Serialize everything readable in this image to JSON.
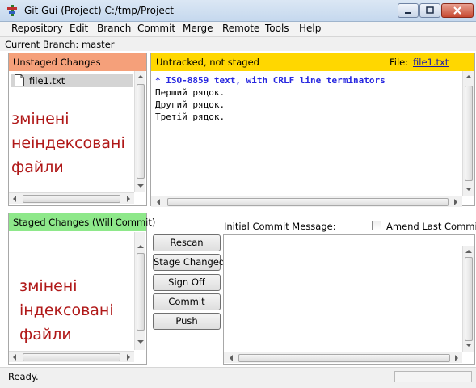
{
  "window": {
    "title": "Git Gui (Project) C:/tmp/Project"
  },
  "menu": [
    "Repository",
    "Edit",
    "Branch",
    "Commit",
    "Merge",
    "Remote",
    "Tools",
    "Help"
  ],
  "branch_line": "Current Branch: master",
  "unstaged": {
    "header": "Unstaged Changes",
    "header_color": "#f5a07a",
    "files": [
      "file1.txt"
    ],
    "annotation": [
      "змінені",
      "неіндексовані",
      "файли"
    ]
  },
  "diff": {
    "header_status": "Untracked, not staged",
    "header_color": "#ffd700",
    "file_label": "File:",
    "file_name": "file1.txt",
    "lines": [
      "* ISO-8859 text, with CRLF line terminators",
      "Перший рядок.",
      "Другий рядок.",
      "Третій рядок."
    ]
  },
  "staged": {
    "header": "Staged Changes (Will Commit)",
    "header_color": "#8ee88a",
    "annotation": [
      "змінені",
      "індексовані",
      "файли"
    ]
  },
  "commit": {
    "message_label": "Initial Commit Message:",
    "amend_label": "Amend Last Commit",
    "amend_checked": false,
    "message": ""
  },
  "buttons": [
    "Rescan",
    "Stage Changed",
    "Sign Off",
    "Commit",
    "Push"
  ],
  "status": "Ready.",
  "annotation_color": "#b01818"
}
